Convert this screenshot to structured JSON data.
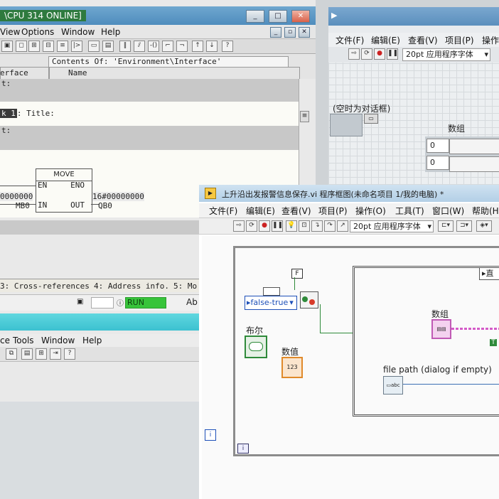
{
  "step7": {
    "title": "\\CPU 314  ONLINE]",
    "menu": [
      "View",
      "Options",
      "Window",
      "Help"
    ],
    "contents_label": "Contents Of: 'Environment\\Interface'",
    "interface_tab": "erface",
    "name_col": "Name",
    "editor_row1": "t:",
    "network_label": "k 1",
    "title_label": ": Title:",
    "comment_label": "t:",
    "move_block": {
      "name": "MOVE",
      "en": "EN",
      "eno": "ENO",
      "in": "IN",
      "out": "OUT"
    },
    "in_value": "0000000",
    "in_addr": "MB0",
    "out_value": "16#00000000",
    "out_addr": "QB0",
    "tabs": [
      "3: Cross-references",
      "4: Address info.",
      "5: Mo"
    ],
    "run_status": "RUN",
    "abs_label": "Ab",
    "sub_menu": [
      "ce",
      "Tools",
      "Window",
      "Help"
    ]
  },
  "front_panel": {
    "menu": [
      "文件(F)",
      "编辑(E)",
      "查看(V)",
      "项目(P)",
      "操作"
    ],
    "font_select": "20pt 应用程序字体",
    "empty_dialog_label": "(空时为对话框)",
    "array_label": "数组",
    "numeric_values": [
      "0",
      "0"
    ]
  },
  "block_diagram": {
    "title": "上升沿出发报警信息保存.vi 程序框图(未命名项目 1/我的电脑) *",
    "menu": [
      "文件(F)",
      "编辑(E)",
      "查看(V)",
      "项目(P)",
      "操作(O)",
      "工具(T)",
      "窗口(W)",
      "帮助(H"
    ],
    "font_select": "20pt 应用程序字体",
    "enum_value": "false-true",
    "bool_label": "布尔",
    "numeric_label": "数值",
    "array_label": "数组",
    "file_path_label": "file path (dialog if empty)",
    "f_const": "F",
    "case_label": "直",
    "numeric_icon": "123",
    "path_icon": "abc"
  },
  "colors": {
    "title_green": "#2e7a3e",
    "run_green": "#37c43a",
    "labview_bool": "#2f8a3a",
    "labview_numeric": "#e08a2a",
    "labview_string": "#d45bc8"
  }
}
